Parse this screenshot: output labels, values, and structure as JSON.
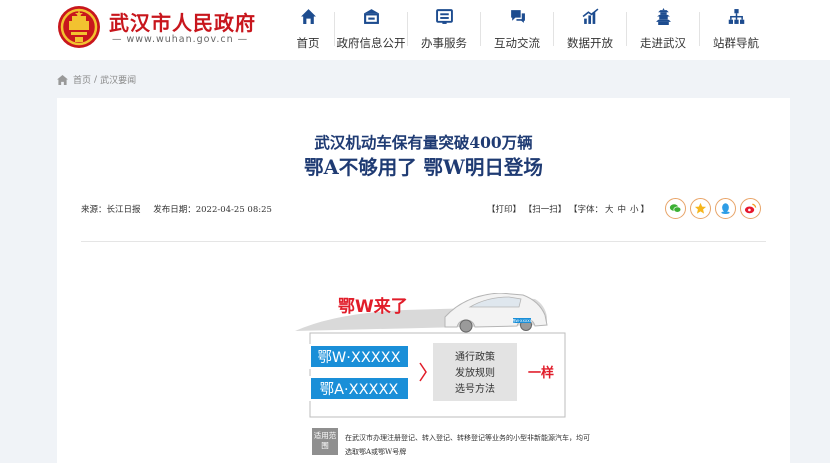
{
  "header": {
    "site_title": "武汉市人民政府",
    "site_url": "— www.wuhan.gov.cn —",
    "nav": [
      {
        "label": "首页",
        "icon": "home-icon"
      },
      {
        "label": "政府信息公开",
        "icon": "building-icon"
      },
      {
        "label": "办事服务",
        "icon": "service-window-icon"
      },
      {
        "label": "互动交流",
        "icon": "chat-icon"
      },
      {
        "label": "数据开放",
        "icon": "chart-icon"
      },
      {
        "label": "走进武汉",
        "icon": "pagoda-icon"
      },
      {
        "label": "站群导航",
        "icon": "sitemap-icon"
      }
    ]
  },
  "breadcrumb": {
    "home": "首页",
    "separator": "/",
    "current": "武汉要闻"
  },
  "article": {
    "title_line1": "武汉机动车保有量突破400万辆",
    "title_line2": "鄂A不够用了 鄂W明日登场",
    "source": "来源：长江日报",
    "date": "发布日期：2022-04-25 08:25",
    "tools": {
      "print": "【打印】",
      "scan": "【扫一扫】",
      "font_prefix": "【字体：",
      "font_large": "大",
      "font_medium": "中",
      "font_small": "小",
      "font_suffix": "】"
    },
    "share_icons": [
      "wechat-icon",
      "qzone-icon",
      "qq-icon",
      "weibo-icon"
    ]
  },
  "figure": {
    "headline": "鄂W来了",
    "plate_w": "鄂W·XXXXX",
    "plate_a": "鄂A·XXXXX",
    "items": [
      "通行政策",
      "发放规则",
      "选号方法"
    ],
    "same": "一样",
    "scope_tag": "适用范围",
    "scope_text": "在武汉市办理注册登记、转入登记、转移登记等业务的小型非新能源汽车，均可选取鄂A或鄂W号牌",
    "car_plate_text": "鄂W·XXXXX"
  },
  "colors": {
    "brand_red": "#c8161d",
    "title_blue": "#1f3b73",
    "nav_icon": "#1d4c8f",
    "plate_blue": "#1a8fd8",
    "figure_red": "#e11d2a"
  }
}
